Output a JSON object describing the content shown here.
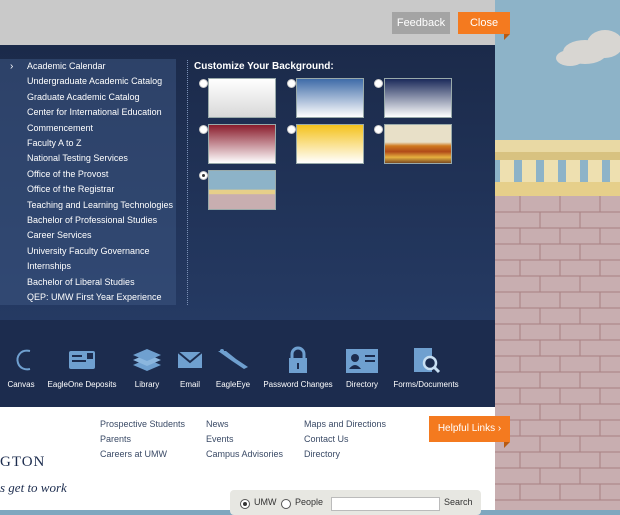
{
  "topbar": {
    "feedback_label": "Feedback",
    "close_label": "Close"
  },
  "quicklinks": [
    "Academic Calendar",
    "Undergraduate Academic Catalog",
    "Graduate Academic Catalog",
    "Center for International Education",
    "Commencement",
    "Faculty A to Z",
    "National Testing Services",
    "Office of the Provost",
    "Office of the Registrar",
    "Teaching and Learning Technologies",
    "Bachelor of Professional Studies",
    "Career Services",
    "University Faculty Governance",
    "Internships",
    "Bachelor of Liberal Studies",
    "QEP: UMW First Year Experience"
  ],
  "backgrounds": {
    "title": "Customize Your Background:",
    "options": [
      "white-gradient",
      "blue-sky-gradient",
      "navy-gradient",
      "maroon-gradient",
      "gold-gradient",
      "autumn-leaves",
      "castle-wall"
    ],
    "selected": "castle-wall"
  },
  "services": [
    {
      "label": "Canvas",
      "icon": "canvas-icon"
    },
    {
      "label": "EagleOne Deposits",
      "icon": "card-deposit-icon"
    },
    {
      "label": "Library",
      "icon": "books-icon"
    },
    {
      "label": "Email",
      "icon": "envelope-icon"
    },
    {
      "label": "EagleEye",
      "icon": "eagle-icon"
    },
    {
      "label": "Password Changes",
      "icon": "padlock-icon"
    },
    {
      "label": "Directory",
      "icon": "id-card-icon"
    },
    {
      "label": "Forms/Documents",
      "icon": "document-search-icon"
    }
  ],
  "footer": {
    "col1": [
      "Prospective Students",
      "Parents",
      "Careers at UMW"
    ],
    "col2": [
      "News",
      "Events",
      "Campus Advisories"
    ],
    "col3": [
      "Maps and Directions",
      "Contact Us",
      "Directory"
    ],
    "helpful": "Helpful Links ›",
    "logo_line1": "GTON",
    "logo_line2": "s get to work"
  },
  "search": {
    "opt1": "UMW",
    "opt2": "People",
    "button": "Search"
  },
  "colors": {
    "navy": "#1c2c4e",
    "accent": "#f47a1f"
  }
}
